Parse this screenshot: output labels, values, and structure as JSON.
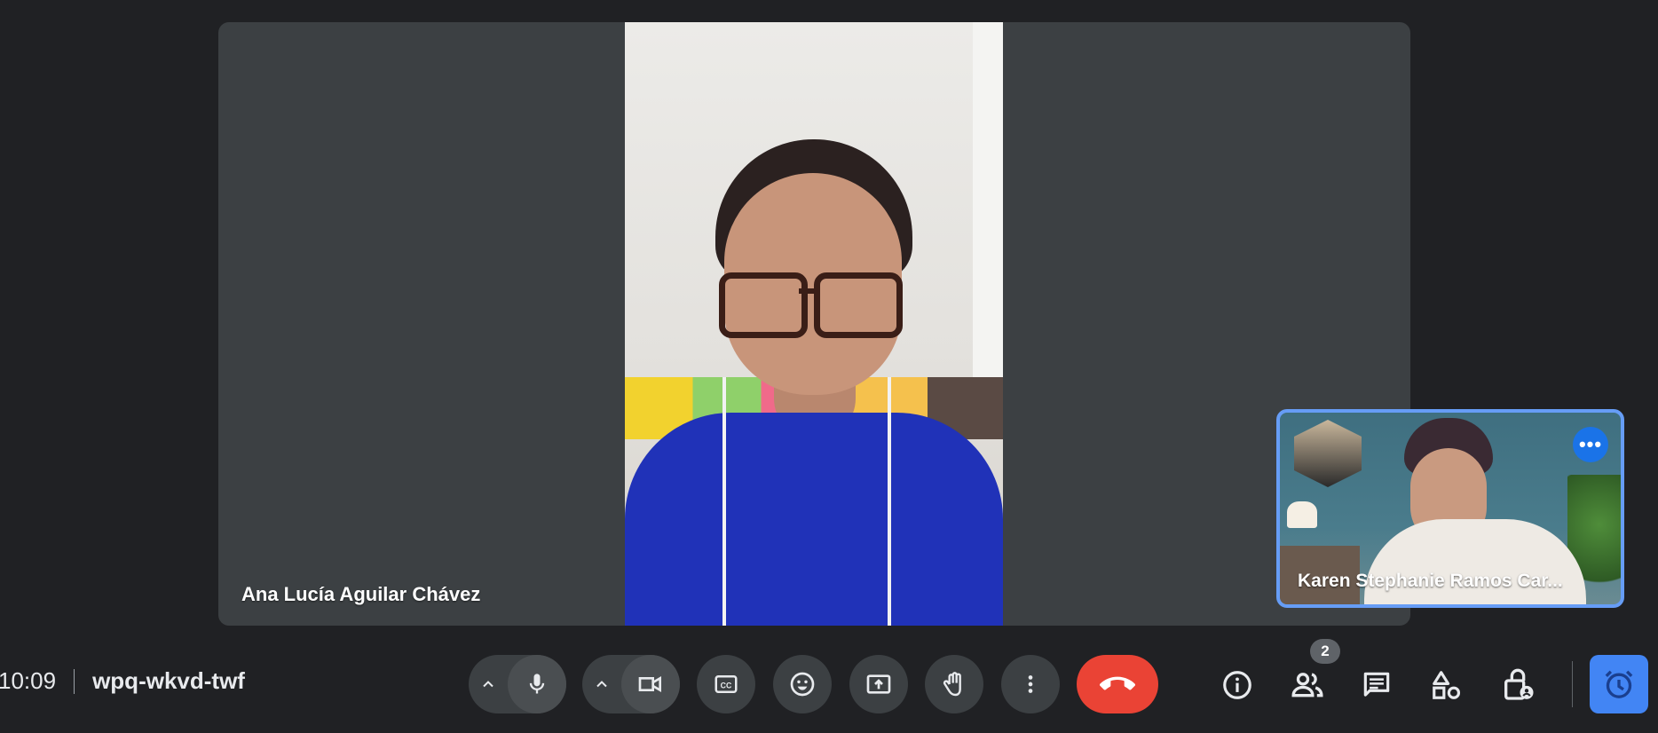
{
  "main_participant": {
    "name": "Ana Lucía Aguilar Chávez"
  },
  "pip_participant": {
    "name": "Karen Stephanie Ramos Car...",
    "more_label": "•••"
  },
  "meeting": {
    "time": "10:09",
    "code": "wpq-wkvd-twf"
  },
  "people": {
    "count": "2"
  },
  "colors": {
    "background": "#202124",
    "tile": "#3c4043",
    "end_call": "#ea4335",
    "accent": "#4285f4",
    "pip_border": "#669df6"
  },
  "icons": {
    "mic": "mic-icon",
    "camera": "videocam-icon",
    "captions": "closed-caption-icon",
    "emoji": "emoji-icon",
    "present": "present-screen-icon",
    "hand": "raise-hand-icon",
    "more": "more-vert-icon",
    "end": "call-end-icon",
    "info": "info-icon",
    "people": "people-icon",
    "chat": "chat-icon",
    "activities": "activities-icon",
    "host": "host-controls-icon",
    "timer": "alarm-icon"
  }
}
